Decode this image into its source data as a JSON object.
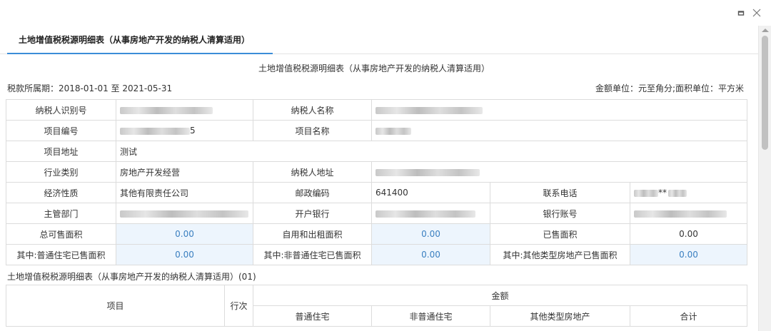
{
  "tab": {
    "label": "土地增值税税源明细表（从事房地产开发的纳税人清算适用）"
  },
  "doc": {
    "title": "土地增值税税源明细表（从事房地产开发的纳税人清算适用）",
    "period": "税款所属期：2018-01-01 至 2021-05-31",
    "units": "金额单位：元至角分;面积单位：平方米"
  },
  "info": {
    "taxpayer_id_label": "纳税人识别号",
    "taxpayer_name_label": "纳税人名称",
    "project_no_label": "项目编号",
    "project_no_value": "5",
    "project_name_label": "项目名称",
    "project_addr_label": "项目地址",
    "project_addr_value": "测试",
    "industry_label": "行业类别",
    "industry_value": "房地产开发经营",
    "taxpayer_addr_label": "纳税人地址",
    "econ_label": "经济性质",
    "econ_value": "其他有限责任公司",
    "postal_label": "邮政编码",
    "postal_value": "641400",
    "phone_label": "联系电话",
    "phone_value": "**",
    "dept_label": "主管部门",
    "bank_label": "开户银行",
    "account_label": "银行账号",
    "total_area_label": "总可售面积",
    "total_area_value": "0.00",
    "self_use_label": "自用和出租面积",
    "self_use_value": "0.00",
    "sold_label": "已售面积",
    "sold_value": "0.00",
    "ordinary_sold_label": "其中:普通住宅已售面积",
    "ordinary_sold_value": "0.00",
    "nonordinary_sold_label": "其中:非普通住宅已售面积",
    "nonordinary_sold_value": "0.00",
    "other_sold_label": "其中:其他类型房地产已售面积",
    "other_sold_value": "0.00"
  },
  "section": {
    "title": "土地增值税税源明细表（从事房地产开发的纳税人清算适用）(01)"
  },
  "detail": {
    "item_label": "项目",
    "row_label": "行次",
    "amount_label": "金额",
    "ordinary_label": "普通住宅",
    "nonordinary_label": "非普通住宅",
    "other_label": "其他类型房地产",
    "total_label": "合计"
  }
}
